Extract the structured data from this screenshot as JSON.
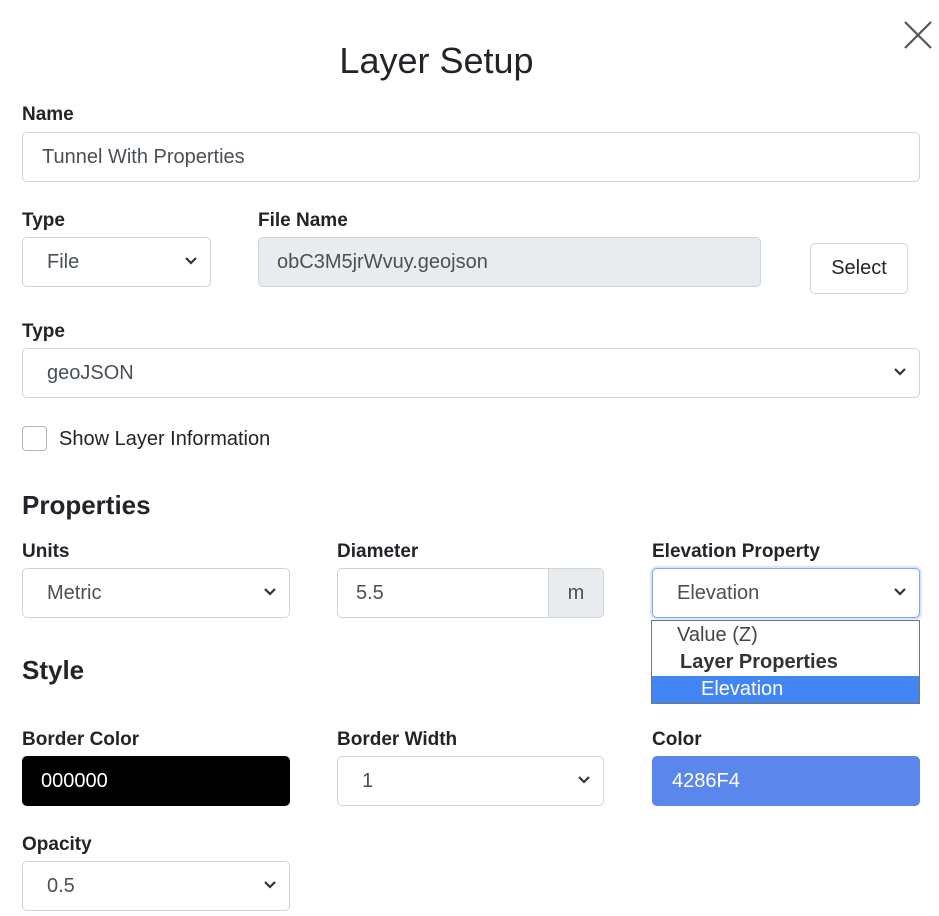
{
  "dialog": {
    "title": "Layer Setup"
  },
  "name_field": {
    "label": "Name",
    "value": "Tunnel With Properties"
  },
  "source": {
    "type_label": "Type",
    "type_value": "File",
    "file_name_label": "File Name",
    "file_name_value": "obC3M5jrWvuy.geojson",
    "select_button": "Select"
  },
  "format": {
    "label": "Type",
    "value": "geoJSON"
  },
  "show_layer_info": {
    "label": "Show Layer Information",
    "checked": false
  },
  "properties": {
    "heading": "Properties",
    "units_label": "Units",
    "units_value": "Metric",
    "diameter_label": "Diameter",
    "diameter_value": "5.5",
    "diameter_unit": "m",
    "elevation_label": "Elevation Property",
    "elevation_value": "Elevation",
    "elevation_options": {
      "option_value_z": "Value (Z)",
      "group_label": "Layer Properties",
      "option_elevation": "Elevation"
    }
  },
  "style": {
    "heading": "Style",
    "border_color_label": "Border Color",
    "border_color_value": "000000",
    "border_width_label": "Border Width",
    "border_width_value": "1",
    "color_label": "Color",
    "color_value": "4286F4",
    "opacity_label": "Opacity",
    "opacity_value": "0.5"
  },
  "colors": {
    "border_color_swatch": "#000000",
    "fill_color_swatch": "#5b86eb",
    "dropdown_highlight": "#4286f4"
  },
  "icons": {
    "close": "close-icon",
    "select_arrow": "chevron-down-icon"
  }
}
